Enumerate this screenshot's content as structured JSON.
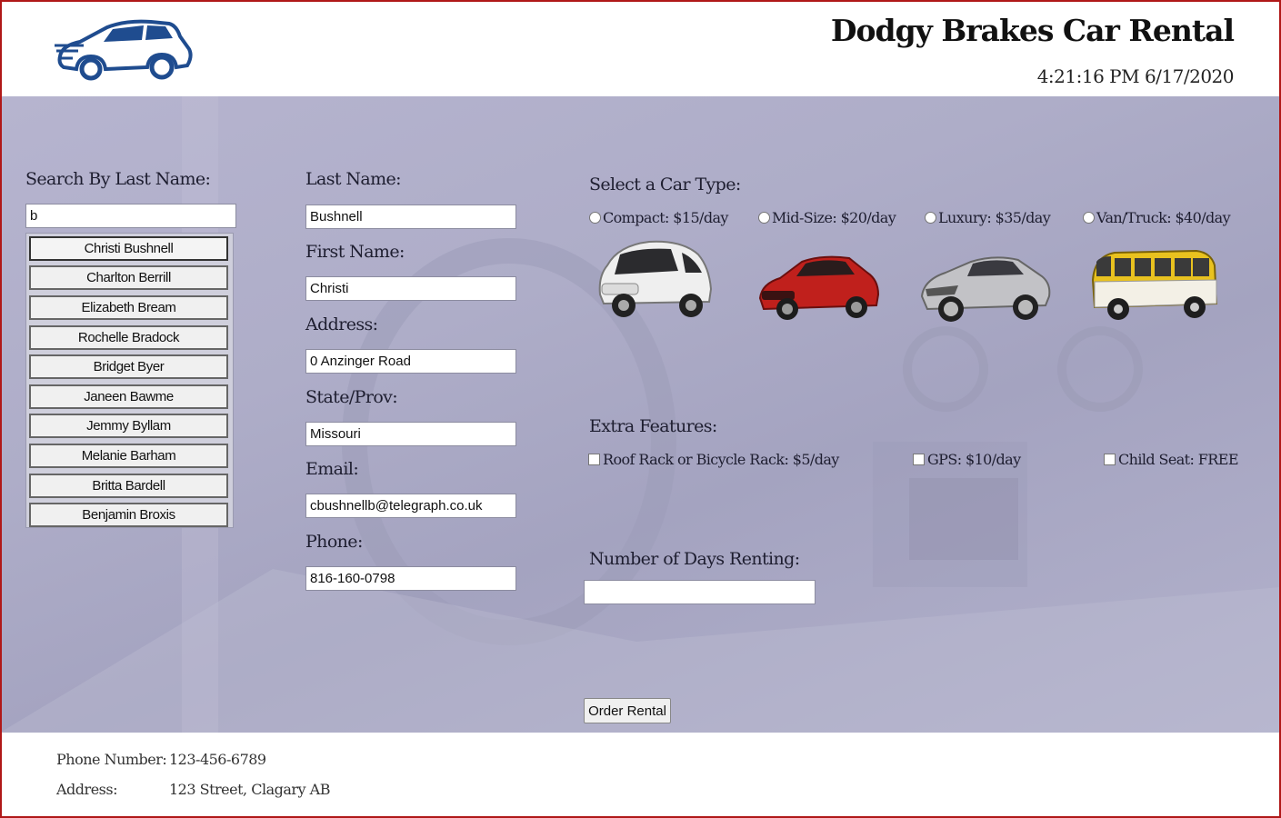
{
  "header": {
    "title": "Dodgy Brakes Car Rental",
    "clock": "4:21:16 PM 6/17/2020"
  },
  "search": {
    "label": "Search By Last Name:",
    "value": "b",
    "results": [
      "Christi Bushnell",
      "Charlton Berrill",
      "Elizabeth Bream",
      "Rochelle Bradock",
      "Bridget Byer",
      "Janeen Bawme",
      "Jemmy Byllam",
      "Melanie Barham",
      "Britta Bardell",
      "Benjamin Broxis"
    ]
  },
  "customer": {
    "last_name_label": "Last Name:",
    "last_name": "Bushnell",
    "first_name_label": "First Name:",
    "first_name": "Christi",
    "address_label": "Address:",
    "address": "0 Anzinger Road",
    "state_label": "State/Prov:",
    "state": "Missouri",
    "email_label": "Email:",
    "email": "cbushnellb@telegraph.co.uk",
    "phone_label": "Phone:",
    "phone": "816-160-0798"
  },
  "car_types": {
    "label": "Select a Car Type:",
    "options": [
      {
        "label": "Compact: $15/day",
        "icon": "compact-car-icon",
        "color": "#e8e8e8"
      },
      {
        "label": "Mid-Size: $20/day",
        "icon": "midsize-car-icon",
        "color": "#c0201c"
      },
      {
        "label": "Luxury: $35/day",
        "icon": "luxury-car-icon",
        "color": "#b8b8bc"
      },
      {
        "label": "Van/Truck: $40/day",
        "icon": "van-icon",
        "color": "#e9c21f"
      }
    ]
  },
  "extras": {
    "label": "Extra Features:",
    "options": [
      "Roof Rack or Bicycle Rack: $5/day",
      "GPS: $10/day",
      "Child Seat: FREE"
    ]
  },
  "days": {
    "label": "Number of Days Renting:",
    "value": ""
  },
  "order_button": "Order Rental",
  "footer": {
    "phone_label": "Phone Number:",
    "phone": "123-456-6789",
    "address_label": "Address:",
    "address": "123 Street, Clagary AB"
  },
  "colors": {
    "brand_blue": "#1f4c8f",
    "main_bg": "#aeadc8",
    "frame_red": "#b01818"
  }
}
